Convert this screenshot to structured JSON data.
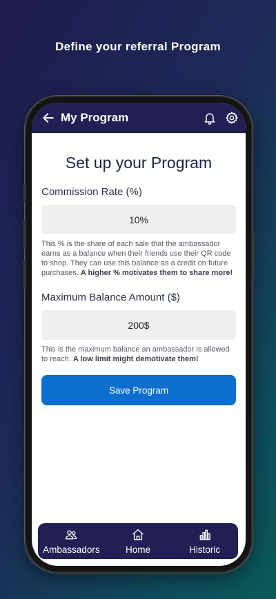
{
  "promo": {
    "title": "Define your referral Program"
  },
  "appbar": {
    "title": "My Program",
    "icons": [
      "back-arrow-icon",
      "bell-icon",
      "gear-icon"
    ]
  },
  "page": {
    "heading": "Set up your Program",
    "commission": {
      "label": "Commission Rate (%)",
      "value": "10%",
      "help_plain": "This % is the share of each sale that the ambassador earns as a balance when their friends use their QR code to shop. They can use this balance as a credit on future purchases. ",
      "help_bold": "A higher % motivates them to share more!"
    },
    "max_balance": {
      "label": "Maximum Balance Amount ($)",
      "value": "200$",
      "help_plain": "This is the maximum balance an ambassador is allowed to reach. ",
      "help_bold": "A low limit might demotivate them!"
    },
    "save_label": "Save Program"
  },
  "bottom_nav": {
    "items": [
      {
        "label": "Ambassadors",
        "icon": "users-icon"
      },
      {
        "label": "Home",
        "icon": "home-icon"
      },
      {
        "label": "Historic",
        "icon": "bar-chart-icon"
      }
    ]
  },
  "colors": {
    "primary_dark": "#221f55",
    "button_blue": "#0c6fce",
    "input_bg": "#efefef"
  }
}
